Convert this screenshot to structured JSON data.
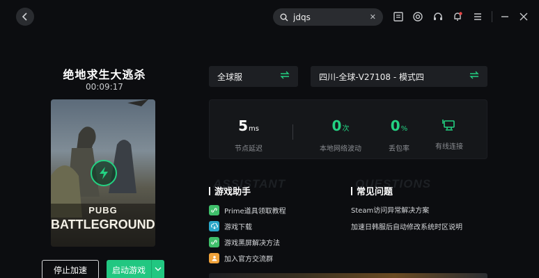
{
  "header": {
    "search": {
      "value": "jdqs"
    },
    "icons": [
      "shield-badge-icon",
      "target-icon",
      "headset-icon",
      "bell-icon",
      "menu-icon",
      "minimize-icon",
      "close-icon"
    ]
  },
  "game": {
    "title": "绝地求生大逃杀",
    "elapsed": "00:09:17",
    "cover_text": {
      "line1": "PUBG",
      "line2": "BATTLEGROUNDS"
    },
    "stop_label": "停止加速",
    "start_label": "启动游戏"
  },
  "servers": {
    "region": "全球服",
    "node": "四川-全球-V27108 - 模式四"
  },
  "stats": [
    {
      "value": "5",
      "unit": "ms",
      "label": "节点延迟",
      "color": "#ffffff"
    },
    {
      "value": "0",
      "unit": "次",
      "label": "本地网络波动",
      "color": "#23d282"
    },
    {
      "value": "0",
      "unit": "%",
      "label": "丢包率",
      "color": "#23d282"
    },
    {
      "value": "",
      "unit": "",
      "label": "有线连接",
      "color": "#23d282"
    }
  ],
  "assistant": {
    "title": "游戏助手",
    "ghost": "ASSISTANT",
    "items": [
      {
        "label": "Prime道具领取教程",
        "icon": "link-icon",
        "color": "#3fbf6a"
      },
      {
        "label": "游戏下载",
        "icon": "cloud-download-icon",
        "color": "#2aa7c9"
      },
      {
        "label": "游戏黑屏解决方法",
        "icon": "link-icon",
        "color": "#3fbf6a"
      },
      {
        "label": "加入官方交流群",
        "icon": "group-icon",
        "color": "#f0a23a"
      }
    ]
  },
  "faq": {
    "title": "常见问题",
    "ghost": "QUESTIONS",
    "items": [
      {
        "label": "Steam访问异常解决方案"
      },
      {
        "label": "加速日韩服后自动修改系统时区说明"
      }
    ]
  },
  "colors": {
    "accent": "#23d282",
    "background": "#0c0d10",
    "panel": "#1d1f23"
  }
}
